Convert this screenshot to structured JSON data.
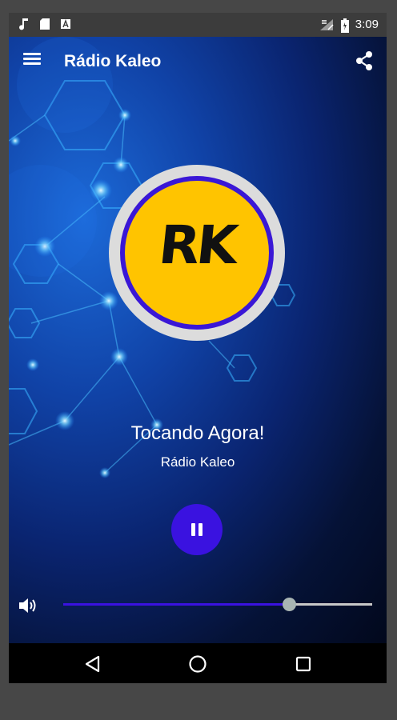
{
  "status_bar": {
    "time": "3:09",
    "icons": [
      "music-note-icon",
      "sd-card-icon",
      "font-icon",
      "no-signal-icon",
      "battery-icon"
    ]
  },
  "toolbar": {
    "title": "Rádio Kaleo",
    "menu_icon": "hamburger-menu-icon",
    "share_icon": "share-icon"
  },
  "logo": {
    "text": "RK",
    "colors": {
      "ring": "#dcdcdc",
      "border": "#3a17d6",
      "fill": "#ffc400"
    }
  },
  "player": {
    "status": "Tocando Agora!",
    "station": "Rádio Kaleo",
    "button_icon": "pause-icon",
    "accent": "#3a12e0"
  },
  "volume": {
    "icon": "speaker-icon",
    "level": 0.73
  },
  "nav_bar": {
    "icons": [
      "back-triangle-icon",
      "home-circle-icon",
      "recents-square-icon"
    ]
  }
}
